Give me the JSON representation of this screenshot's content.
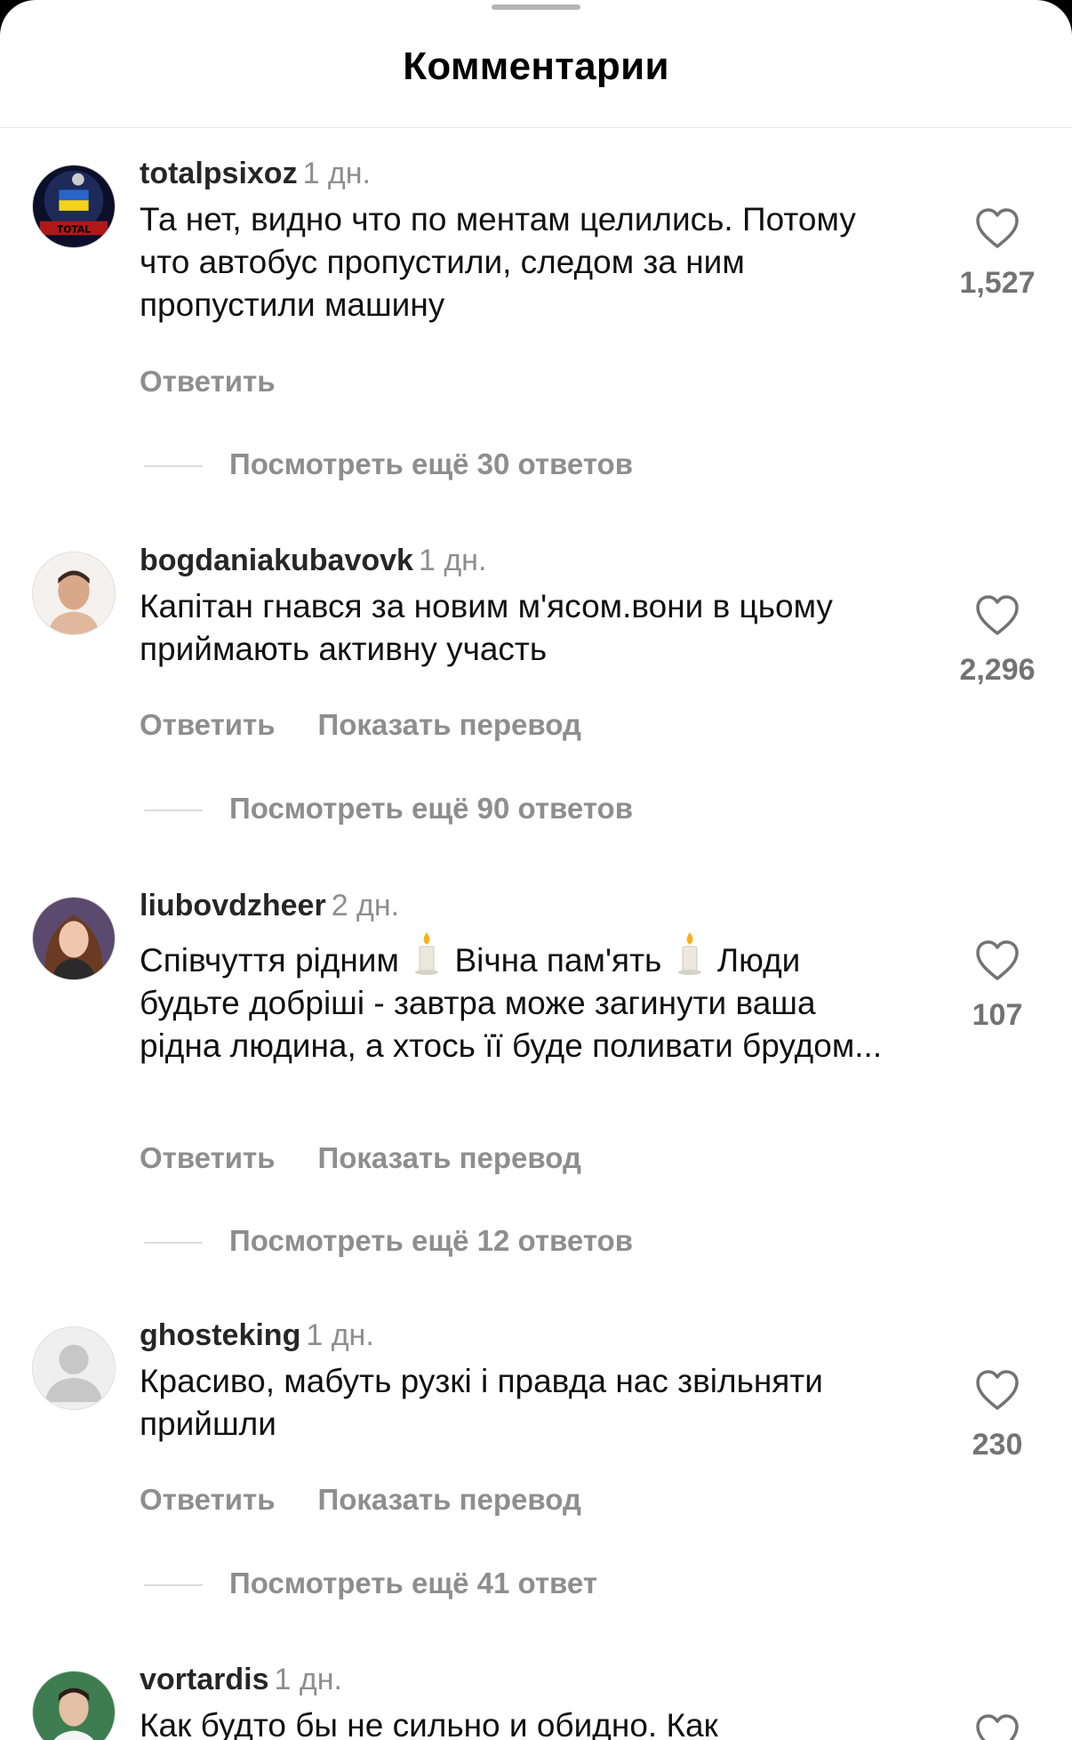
{
  "header": {
    "title": "Комментарии"
  },
  "comments": [
    {
      "username": "totalpsixoz",
      "time": "1 дн.",
      "text": "Та нет, видно что по ментам целились. Потому что автобус пропустили, следом за ним пропустили машину",
      "likes": "1,527",
      "reply_label": "Ответить",
      "view_replies": "Посмотреть ещё 30 ответов"
    },
    {
      "username": "bogdaniakubavovk",
      "time": "1 дн.",
      "text": "Капітан гнався за новим м'ясом.вони в цьому приймають активну участь",
      "likes": "2,296",
      "reply_label": "Ответить",
      "translate_label": "Показать перевод",
      "view_replies": "Посмотреть ещё 90 ответов"
    },
    {
      "username": "liubovdzheer",
      "time": "2 дн.",
      "text_part1": "Співчуття рідним",
      "text_part2": "Вічна пам'ять",
      "text_part3": "Люди будьте добріші - завтра може загинути ваша рідна людина, а хтось її буде поливати брудом...",
      "likes": "107",
      "reply_label": "Ответить",
      "translate_label": "Показать перевод",
      "view_replies": "Посмотреть ещё 12 ответов"
    },
    {
      "username": "ghosteking",
      "time": "1 дн.",
      "text": "Красиво, мабуть рузкі і правда нас звільняти прийшли",
      "likes": "230",
      "reply_label": "Ответить",
      "translate_label": "Показать перевод",
      "view_replies": "Посмотреть ещё 41 ответ"
    },
    {
      "username": "vortardis",
      "time": "1 дн.",
      "text": "Как будто бы не сильно и обидно. Как"
    }
  ],
  "colors": {
    "text": "#111111",
    "secondary": "#8e8e8e",
    "background": "#ffffff"
  }
}
